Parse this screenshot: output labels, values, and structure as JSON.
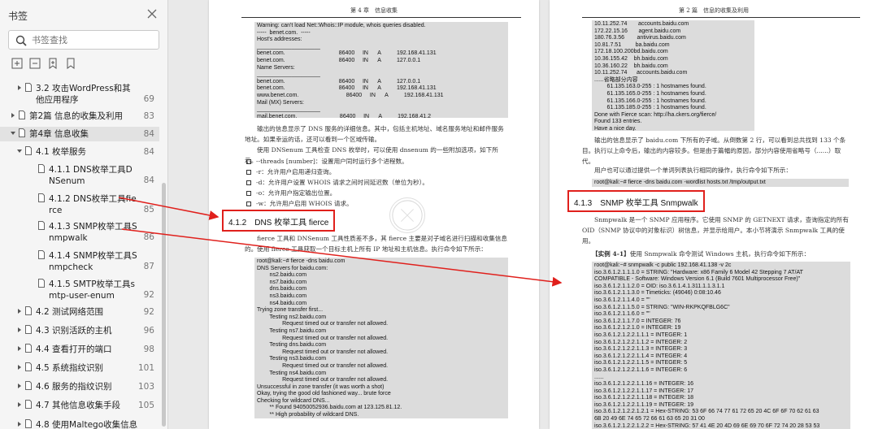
{
  "sidebar": {
    "title": "书签",
    "search_placeholder": "书签查找",
    "items": [
      {
        "label": "3.2 攻击WordPress和其他应用程序",
        "page": "69"
      },
      {
        "label": "第2篇 信息的收集及利用",
        "page": "83"
      },
      {
        "label": "第4章 信息收集",
        "page": "84"
      },
      {
        "label": "4.1 枚举服务",
        "page": "84"
      },
      {
        "label": "4.1.1 DNS枚举工具DNSenum",
        "page": "84"
      },
      {
        "label": "4.1.2 DNS枚举工具fierce",
        "page": "85"
      },
      {
        "label": "4.1.3 SNMP枚举工具Snmpwalk",
        "page": "86"
      },
      {
        "label": "4.1.4 SNMP枚举工具Snmpcheck",
        "page": "87"
      },
      {
        "label": "4.1.5 SMTP枚举工具smtp-user-enum",
        "page": "92"
      },
      {
        "label": "4.2 测试网络范围",
        "page": "92"
      },
      {
        "label": "4.3 识别活跃的主机",
        "page": "96"
      },
      {
        "label": "4.4 查看打开的端口",
        "page": "98"
      },
      {
        "label": "4.5 系统指纹识别",
        "page": "101"
      },
      {
        "label": "4.6 服务的指纹识别",
        "page": "103"
      },
      {
        "label": "4.7 其他信息收集手段",
        "page": "105"
      },
      {
        "label": "4.8 使用Maltego收集信息",
        "page": "106"
      }
    ]
  },
  "page1": {
    "header": "第 4 章　信息收集",
    "code1": "Warning: can't load Net::Whois::IP module, whois queries disabled.\n-----  benet.com.  -----\nHost's addresses:\n____________________\nbenet.com.                                  86400     IN      A          192.168.41.131\nbenet.com.                                  86400     IN      A          127.0.0.1\nName Servers:\n____________________\nbenet.com.                                  86400     IN      A          127.0.0.1\nbenet.com.                                  86400     IN      A          192.168.41.131\nwww.benet.com.                              86400     IN      A          192.168.41.131\nMail (MX) Servers:\n____________________\nmail.benet.com.                           86400     IN      A          192.168.41.2\nTrying Zone Transfers and getting Bind Versions:",
    "para1": "输出的信息显示了 DNS 服务的详细信息。其中，包括主机地址、域名服务地址和邮件服务地址。如果幸运的话，还可以看到一个区域传输。",
    "para2": "使用 DNSenum 工具检查 DNS 枚举时，可以使用 dnsenum 的一些附加选项，如下所示。",
    "options": [
      "--threads [number]：设置用户同时运行多个进程数。",
      "-r：允许用户启用递归查询。",
      "-d：允许用户设置 WHOIS 请求之间时间延迟数（单位为秒）。",
      "-o：允许用户指定输出位置。",
      "-w：允许用户启用 WHOIS 请求。"
    ],
    "section": "4.1.2　DNS 枚举工具 fierce",
    "para3": "fierce 工具和 DNSenum 工具性质差不多，其 fierce 主要是对子域名进行扫描和收集信息的。使用 fierce 工具获取一个目标主机上所有 IP 地址和主机信息。执行命令如下所示：",
    "code2": "root@kali:~# fierce -dns baidu.com\nDNS Servers for baidu.com:\n        ns2.baidu.com\n        ns7.baidu.com\n        dns.baidu.com\n        ns3.baidu.com\n        ns4.baidu.com\nTrying zone transfer first...\n        Testing ns2.baidu.com\n                Request timed out or transfer not allowed.\n        Testing ns7.baidu.com\n                Request timed out or transfer not allowed.\n        Testing dns.baidu.com\n                Request timed out or transfer not allowed.\n        Testing ns3.baidu.com\n                Request timed out or transfer not allowed.\n        Testing ns4.baidu.com\n                Request timed out or transfer not allowed.\nUnsuccessful in zone transfer (it was worth a shot)\nOkay, trying the good old fashioned way... brute force\nChecking for wildcard DNS...\n        ** Found 94050052936.baidu.com at 123.125.81.12.\n        ** High probability of wildcard DNS.\nNow performing 2280 test(s)..."
  },
  "page2": {
    "header": "第 2 篇　信息的收集及利用",
    "code1": "10.11.252.74       accounts.baidu.com\n172.22.15.16       agent.baidu.com\n180.76.3.56        antivirus.baidu.com\n10.81.7.51         ba.baidu.com\n172.18.100.200bd.baidu.com\n10.36.155.42    bh.baidu.com\n10.36.160.22    bh.baidu.com\n10.11.252.74      accounts.baidu.com\n......省略部分内容\n        61.135.163.0-255 : 1 hostnames found.\n        61.135.165.0-255 : 1 hostnames found.\n        61.135.166.0-255 : 1 hostnames found.\n        61.135.185.0-255 : 1 hostnames found.\nDone with Fierce scan: http://ha.ckers.org/fierce/\nFound 133 entries.\nHave a nice day.",
    "para1": "输出的信息显示了 baidu.com 下所有的子域。从倒数第 2 行，可以看到总共找到 133 个条目。执行以上命令后，输出的内容较多。但是由于篇幅的原因，部分内容使用省略号（......）取代。",
    "para2": "用户也可以通过提供一个单词列表执行相同的操作，执行命令如下所示：",
    "cmd": "root@kali:~# fierce -dns baidu.com -wordlist hosts.txt /tmp/output.txt",
    "section": "4.1.3　SNMP 枚举工具 Snmpwalk",
    "para3": "Snmpwalk 是一个 SNMP 应用程序。它使用 SNMP 的 GETNEXT 请求，查询指定的所有 OID（SNMP 协议中的对象标识）树信息，并显示给用户。本小节将演示 Snmpwalk 工具的使用。",
    "example_label": "【实例 4-1】",
    "example_text": "使用 Snmpwalk 命令测试 Windows 主机，执行命令如下所示：",
    "code2": "root@kali:~# snmpwalk -c public 192.168.41.138 -v 2c\niso.3.6.1.2.1.1.1.0 = STRING: \"Hardware: x86 Family 6 Model 42 Stepping 7 AT/AT\nCOMPATIBLE - Software: Windows Version 6.1 (Build 7601 Multiprocessor Free)\"\niso.3.6.1.2.1.1.2.0 = OID: iso.3.6.1.4.1.311.1.1.3.1.1\niso.3.6.1.2.1.1.3.0 = Timeticks: (49046) 0:08:10.46\niso.3.6.1.2.1.1.4.0 = \"\"\niso.3.6.1.2.1.1.5.0 = STRING: \"WIN-RKPKQFBLG6C\"\niso.3.6.1.2.1.1.6.0 = \"\"\niso.3.6.1.2.1.1.7.0 = INTEGER: 76\niso.3.6.1.2.1.2.1.0 = INTEGER: 19\niso.3.6.1.2.1.2.2.1.1.1 = INTEGER: 1\niso.3.6.1.2.1.2.2.1.1.2 = INTEGER: 2\niso.3.6.1.2.1.2.2.1.1.3 = INTEGER: 3\niso.3.6.1.2.1.2.2.1.1.4 = INTEGER: 4\niso.3.6.1.2.1.2.2.1.1.5 = INTEGER: 5\niso.3.6.1.2.1.2.2.1.1.6 = INTEGER: 6\n......\niso.3.6.1.2.1.2.2.1.1.16 = INTEGER: 16\niso.3.6.1.2.1.2.2.1.1.17 = INTEGER: 17\niso.3.6.1.2.1.2.2.1.1.18 = INTEGER: 18\niso.3.6.1.2.1.2.2.1.1.19 = INTEGER: 19\niso.3.6.1.2.1.2.2.1.2.1 = Hex-STRING: 53 6F 66 74 77 61 72 65 20 4C 6F 6F 70 62 61 63\n6B 20 49 6E 74 65 72 66 61 63 65 20 31 00\niso.3.6.1.2.1.2.2.1.2.2 = Hex-STRING: 57 41 4E 20 4D 69 6E 69 70 6F 72 74 20 28 53 53"
  },
  "colors": {
    "accent": "#e0201c",
    "code_bg": "#dcdcdc",
    "sidebar_bg": "#f5f5f5"
  }
}
